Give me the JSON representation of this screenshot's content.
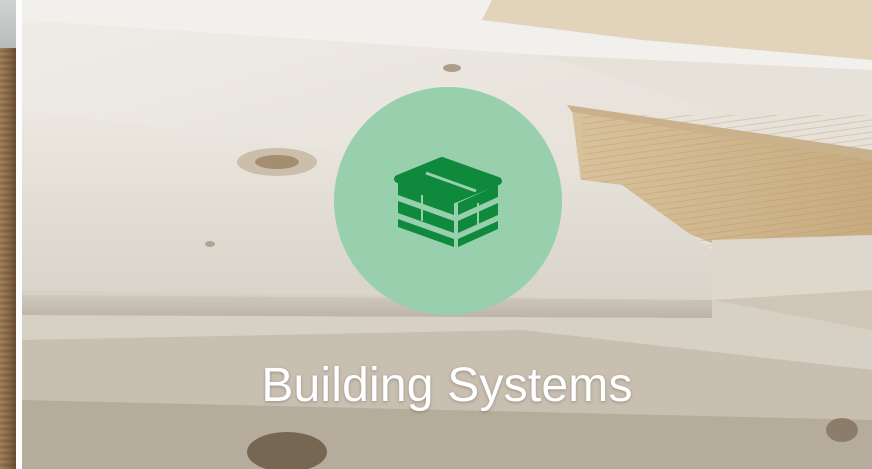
{
  "slide": {
    "title": "Building Systems",
    "icon": "stacked-timber-icon",
    "badge_color": "#98d0ad",
    "icon_color": "#0f8a3c"
  }
}
